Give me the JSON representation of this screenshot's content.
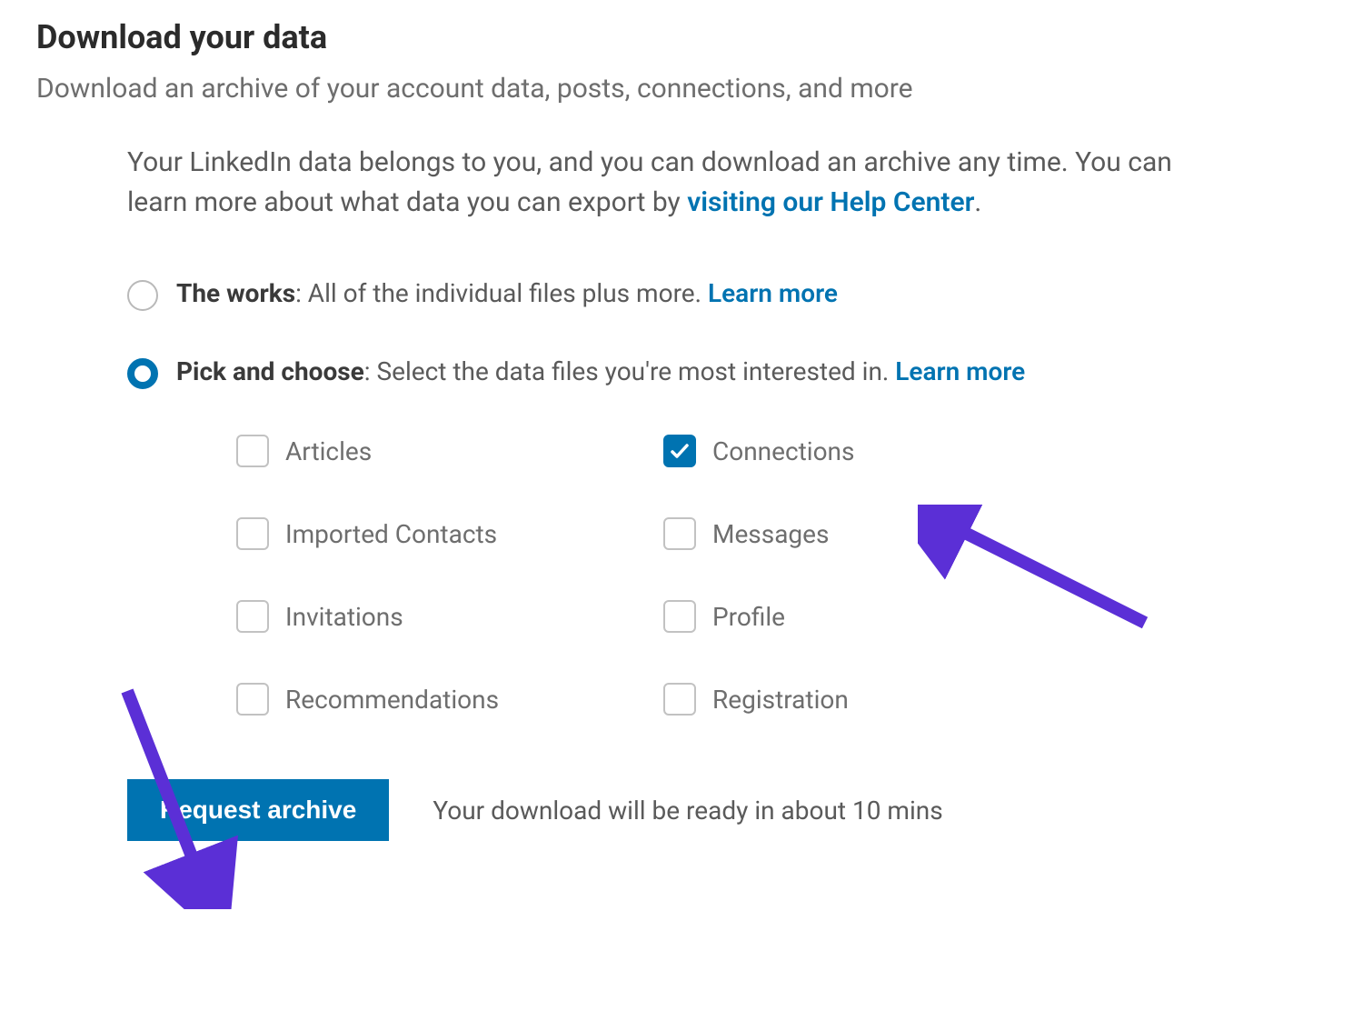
{
  "header": {
    "title": "Download your data",
    "subtitle": "Download an archive of your account data, posts, connections, and more"
  },
  "info": {
    "text_before_link": "Your LinkedIn data belongs to you, and you can download an archive any time. You can learn more about what data you can export by ",
    "link_text": "visiting our Help Center",
    "text_after_link": "."
  },
  "options": {
    "the_works": {
      "bold": "The works",
      "desc": ": All of the individual files plus more. ",
      "learn_more": "Learn more",
      "selected": false
    },
    "pick_and_choose": {
      "bold": "Pick and choose",
      "desc": ": Select the data files you're most interested in. ",
      "learn_more": "Learn more",
      "selected": true
    }
  },
  "checkboxes": [
    {
      "label": "Articles",
      "checked": false
    },
    {
      "label": "Connections",
      "checked": true
    },
    {
      "label": "Imported Contacts",
      "checked": false
    },
    {
      "label": "Messages",
      "checked": false
    },
    {
      "label": "Invitations",
      "checked": false
    },
    {
      "label": "Profile",
      "checked": false
    },
    {
      "label": "Recommendations",
      "checked": false
    },
    {
      "label": "Registration",
      "checked": false
    }
  ],
  "action": {
    "button_label": "Request archive",
    "status_text": "Your download will be ready in about 10 mins"
  },
  "colors": {
    "link": "#0073b1",
    "arrow": "#5b2fd6"
  }
}
